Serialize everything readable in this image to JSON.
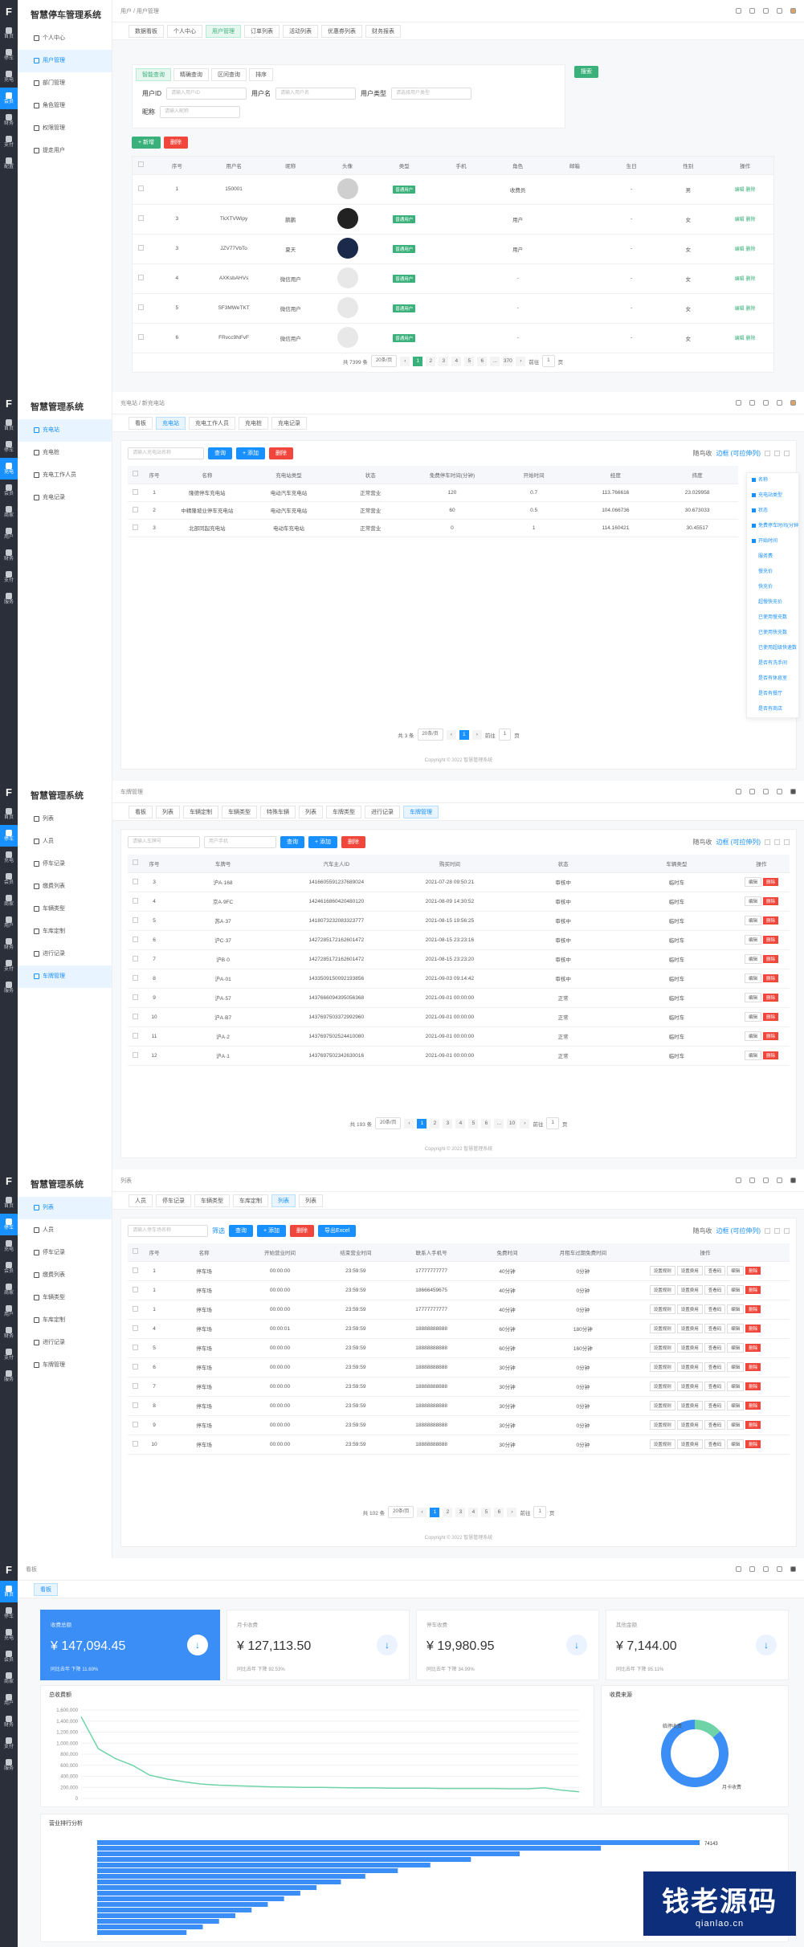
{
  "app_title": "智慧停车管理系统",
  "app_title2": "智慧管理系统",
  "rail": [
    "首页",
    "停车",
    "充电",
    "会员",
    "财务",
    "商家",
    "配置",
    "用户",
    "支付",
    "服务"
  ],
  "p1": {
    "subtitle": "用户",
    "menu": [
      "个人中心",
      "用户管理",
      "部门管理",
      "角色管理",
      "权限管理",
      "提走用户"
    ],
    "breadcrumb": "用户 / 用户管理",
    "tabs": [
      "数据看板",
      "个人中心",
      "用户管理",
      "订单列表",
      "活动列表",
      "优惠券列表",
      "财务报表"
    ],
    "filter_tabs": [
      "智能查询",
      "精确查询",
      "区间查询",
      "排序"
    ],
    "f_username": "用户ID",
    "f_username_ph": "请输入用户ID",
    "f_name": "用户名",
    "f_name_ph": "请输入用户名",
    "f_type": "用户类型",
    "f_type_ph": "请选择用户类型",
    "f_nick": "昵称",
    "f_nick_ph": "请输入昵称",
    "search": "搜索",
    "add": "+ 新增",
    "del": "删除",
    "cols": [
      "序号",
      "用户名",
      "昵称",
      "头像",
      "类型",
      "手机",
      "角色",
      "邮箱",
      "生日",
      "性别",
      "操作"
    ],
    "rows": [
      [
        "1",
        "150001",
        "",
        "",
        "普通用户",
        "",
        "收费员",
        "",
        "-",
        "男"
      ],
      [
        "3",
        "TkXTVWipy",
        "鹏鹏",
        "",
        "普通用户",
        "",
        "用户",
        "",
        "-",
        "女"
      ],
      [
        "3",
        "JZV77VbTo",
        "夏天",
        "",
        "普通用户",
        "",
        "用户",
        "",
        "-",
        "女"
      ],
      [
        "4",
        "AXKsbAHVs",
        "微信用户",
        "",
        "普通用户",
        "",
        "-",
        "",
        "-",
        "女"
      ],
      [
        "5",
        "SF3MWeTKT",
        "微信用户",
        "",
        "普通用户",
        "",
        "-",
        "",
        "-",
        "女"
      ],
      [
        "6",
        "FRvcc9NFvF",
        "微信用户",
        "",
        "普通用户",
        "",
        "-",
        "",
        "-",
        "女"
      ]
    ],
    "op_edit": "编辑",
    "op_del": "删除",
    "pager": [
      "共 7399 条",
      "20条/页",
      "1",
      "2",
      "3",
      "4",
      "5",
      "6",
      "...",
      "370",
      "前往",
      "1",
      "页"
    ]
  },
  "p2": {
    "subtitle": "充电",
    "menu": [
      "充电站",
      "充电桩",
      "充电工作人员",
      "充电记录"
    ],
    "breadcrumb": "充电站 / 新充电站",
    "tabs": [
      "看板",
      "充电站",
      "充电工作人员",
      "充电桩",
      "充电记录"
    ],
    "search_ph": "请输入充电站名称",
    "query": "查询",
    "add": "+ 添加",
    "del": "删除",
    "right_opts": [
      "随鸟收",
      "边框 (可拉伸列)"
    ],
    "cols": [
      "序号",
      "名称",
      "充电站类型",
      "状态",
      "免费停车时间(分钟)",
      "开始时间",
      "经度",
      "纬度"
    ],
    "rows": [
      [
        "1",
        "隆德停车充电站",
        "电动汽车充电站",
        "正常营业",
        "120",
        "0.7",
        "113.766616",
        "23.029958"
      ],
      [
        "2",
        "中精隆坡业停车充电站",
        "电动汽车充电站",
        "正常营业",
        "60",
        "0.5",
        "104.066736",
        "30.673033"
      ],
      [
        "3",
        "北部同起充电站",
        "电动车充电站",
        "正常营业",
        "0",
        "1",
        "114.160421",
        "30.45517"
      ]
    ],
    "colpanel": [
      "名称",
      "充电站类型",
      "状态",
      "免费停车时间(分钟)",
      "开始时间",
      "服务费",
      "慢充价",
      "快充价",
      "超慢快充价",
      "已使用慢充数",
      "已使用快充数",
      "已使用超级快速数",
      "是否有洗手间",
      "是否有休息室",
      "是否有餐厅",
      "是否有商店"
    ],
    "pager": [
      "共 3 条",
      "20条/页",
      "1",
      "前往",
      "1",
      "页"
    ],
    "copyright": "Copyright © 2022 智慧管理系统"
  },
  "p3": {
    "subtitle": "停车",
    "menu": [
      "列表",
      "人员",
      "停车记录",
      "缴费列表",
      "车辆类型",
      "车库定制",
      "进行记录",
      "车牌管理"
    ],
    "breadcrumb": "车牌管理",
    "tabs": [
      "看板",
      "列表",
      "车辆定制",
      "车辆类型",
      "特殊车辆",
      "列表",
      "车牌类型",
      "进行记录",
      "车牌管理"
    ],
    "ph1": "请输入车牌号",
    "ph2": "用户手机",
    "query": "查询",
    "add": "+ 添加",
    "del": "删除",
    "right_opts": [
      "随鸟收",
      "边框 (可拉伸列)"
    ],
    "cols": [
      "序号",
      "车牌号",
      "汽车主人ID",
      "购买时间",
      "状态",
      "车辆类型",
      "操作"
    ],
    "rows": [
      [
        "3",
        "沪A·168",
        "1416605591237689024",
        "2021-07-28 09:50:21",
        "审核中",
        "临时车"
      ],
      [
        "4",
        "京A·9FC",
        "1424616860420480120",
        "2021-08-09 14:30:52",
        "审核中",
        "临时车"
      ],
      [
        "5",
        "苏A·37",
        "1418073232083323777",
        "2021-08-15 19:56:25",
        "审核中",
        "临时车"
      ],
      [
        "6",
        "沪C·37",
        "1427285172162601472",
        "2021-08-15 23:23:16",
        "审核中",
        "临时车"
      ],
      [
        "7",
        "沪B·0",
        "1427285172162601472",
        "2021-08-15 23:23:20",
        "审核中",
        "临时车"
      ],
      [
        "8",
        "沪A·01",
        "1433509150092193856",
        "2021-09-03 09:14:42",
        "审核中",
        "临时车"
      ],
      [
        "9",
        "沪A·57",
        "1437666094395056368",
        "2021-09-01 00:00:00",
        "正常",
        "临时车"
      ],
      [
        "10",
        "沪A·B7",
        "1437697503372992960",
        "2021-09-01 00:00:00",
        "正常",
        "临时车"
      ],
      [
        "11",
        "沪A·2",
        "1437697502524410080",
        "2021-09-01 00:00:00",
        "正常",
        "临时车"
      ],
      [
        "12",
        "沪A·1",
        "1437697502342630016",
        "2021-09-01 00:00:00",
        "正常",
        "临时车"
      ]
    ],
    "op_edit": "编辑",
    "op_del": "删除",
    "pager": [
      "共 193 条",
      "20条/页",
      "1",
      "2",
      "3",
      "4",
      "5",
      "6",
      "...",
      "10",
      "前往",
      "1",
      "页"
    ],
    "copyright": "Copyright © 2022 智慧管理系统"
  },
  "p4": {
    "subtitle": "停车",
    "menu": [
      "列表",
      "人员",
      "停车记录",
      "缴费列表",
      "车辆类型",
      "车库定制",
      "进行记录",
      "车牌管理"
    ],
    "breadcrumb": "列表",
    "tabs": [
      "人员",
      "停车记录",
      "车辆类型",
      "车库定制",
      "列表",
      "列表"
    ],
    "ph1": "请输入停车场名称",
    "filter": "筛选",
    "query": "查询",
    "add": "+ 添加",
    "del": "删除",
    "export": "导出Excel",
    "right_opts": [
      "随鸟收",
      "边框 (可拉伸列)"
    ],
    "cols": [
      "序号",
      "名称",
      "开始营业时间",
      "结束营业时间",
      "联系人手机号",
      "免费时间",
      "月租车过期免费时间",
      "操作"
    ],
    "rows": [
      [
        "1",
        "停车场",
        "00:00:00",
        "23:59:59",
        "17777777777",
        "40分钟",
        "0分钟"
      ],
      [
        "1",
        "停车场",
        "00:00:00",
        "23:59:59",
        "18666459675",
        "40分钟",
        "0分钟"
      ],
      [
        "1",
        "停车场",
        "00:00:00",
        "23:59:59",
        "17777777777",
        "40分钟",
        "0分钟"
      ],
      [
        "4",
        "停车场",
        "00:00:01",
        "23:59:59",
        "18888888888",
        "60分钟",
        "180分钟"
      ],
      [
        "5",
        "停车场",
        "00:00:00",
        "23:59:59",
        "18888888888",
        "60分钟",
        "160分钟"
      ],
      [
        "6",
        "停车场",
        "00:00:00",
        "23:59:59",
        "18888888888",
        "30分钟",
        "0分钟"
      ],
      [
        "7",
        "停车场",
        "00:00:00",
        "23:59:59",
        "18888888888",
        "30分钟",
        "0分钟"
      ],
      [
        "8",
        "停车场",
        "00:00:00",
        "23:59:59",
        "18888888888",
        "30分钟",
        "0分钟"
      ],
      [
        "9",
        "停车场",
        "00:00:00",
        "23:59:59",
        "18888888888",
        "30分钟",
        "0分钟"
      ],
      [
        "10",
        "停车场",
        "00:00:00",
        "23:59:59",
        "18888888888",
        "30分钟",
        "0分钟"
      ]
    ],
    "ops": [
      "设置规则",
      "设置费用",
      "查看码",
      "编辑",
      "删除"
    ],
    "pager": [
      "共 102 条",
      "20条/页",
      "1",
      "2",
      "3",
      "4",
      "5",
      "6",
      "前往",
      "1",
      "页"
    ],
    "copyright": "Copyright © 2022 智慧管理系统"
  },
  "p5": {
    "breadcrumb": "看板",
    "tab": "看板",
    "stats": [
      {
        "label": "收费总额",
        "value": "¥ 147,094.45",
        "foot": "同比去年 下降 11.69%"
      },
      {
        "label": "月卡收费",
        "value": "¥ 127,113.50",
        "foot": "同比去年 下降 92.53%"
      },
      {
        "label": "停车收费",
        "value": "¥ 19,980.95",
        "foot": "同比去年 下降 34.99%"
      },
      {
        "label": "其他金额",
        "value": "¥ 7,144.00",
        "foot": "同比去年 下降 95.11%"
      }
    ],
    "line_title": "总收费额",
    "pie_title": "收费来源",
    "bar_title": "营业排行分析",
    "pie_labels": [
      "临停收费",
      "月卡收费"
    ],
    "bar_top_value": "74143"
  },
  "chart_data": [
    {
      "type": "line",
      "title": "总收费额",
      "ylim": [
        0,
        1600000
      ],
      "yticks": [
        "1,600,000",
        "1,400,000",
        "1,200,000",
        "1,000,000",
        "800,000",
        "600,000",
        "400,000",
        "200,000",
        "0"
      ],
      "values": [
        1480000,
        900000,
        720000,
        600000,
        420000,
        350000,
        300000,
        260000,
        240000,
        230000,
        220000,
        210000,
        205000,
        200000,
        200000,
        195000,
        190000,
        190000,
        185000,
        185000,
        185000,
        180000,
        180000,
        180000,
        180000,
        175000,
        175000,
        190000,
        150000,
        120000
      ]
    },
    {
      "type": "pie",
      "title": "收费来源",
      "labels": [
        "临停收费",
        "月卡收费"
      ],
      "values": [
        13.6,
        86.4
      ]
    },
    {
      "type": "bar",
      "title": "营业排行分析",
      "values": [
        74143,
        62000,
        52000,
        46000,
        41000,
        37000,
        33000,
        30000,
        27000,
        25000,
        23000,
        21000,
        19000,
        17000,
        15000,
        13000,
        11000
      ]
    }
  ],
  "watermark": {
    "main": "钱老源码",
    "sub": "qianlao.cn"
  }
}
